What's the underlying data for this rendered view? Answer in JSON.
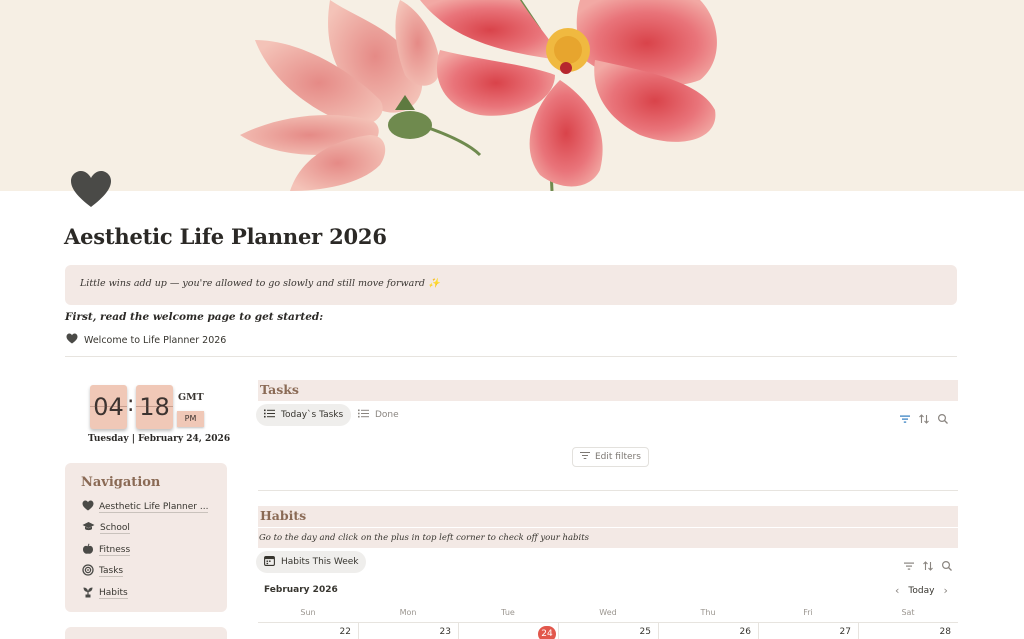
{
  "page": {
    "icon": "heart-icon",
    "title": "Aesthetic Life Planner 2026",
    "callout_text": "Little wins add up — you're allowed to go slowly and still move forward ✨",
    "first_read": "First, read the welcome page to get started:",
    "welcome_link": "Welcome to Life Planner 2026"
  },
  "clock": {
    "hours": "04",
    "separator": ":",
    "minutes": "18",
    "timezone": "GMT",
    "ampm": "PM",
    "date": "Tuesday | February 24, 2026"
  },
  "navigation": {
    "title": "Navigation",
    "items": [
      {
        "label": "Aesthetic Life Planner ...",
        "icon": "heart-icon"
      },
      {
        "label": "School",
        "icon": "graduation-cap-icon"
      },
      {
        "label": "Fitness",
        "icon": "apple-icon"
      },
      {
        "label": "Tasks",
        "icon": "target-icon"
      },
      {
        "label": "Habits",
        "icon": "plant-icon"
      }
    ]
  },
  "tasks": {
    "title": "Tasks",
    "views": [
      {
        "label": "Today`s Tasks",
        "icon": "list-icon",
        "active": true
      },
      {
        "label": "Done",
        "icon": "list-icon",
        "active": false
      }
    ],
    "edit_filters": "Edit filters"
  },
  "habits": {
    "title": "Habits",
    "description": "Go to the day and click on the plus in top left corner to check off your habits",
    "view": {
      "label": "Habits This Week",
      "icon": "calendar-icon"
    },
    "calendar": {
      "month": "February 2026",
      "today_button": "Today",
      "weekdays": [
        "Sun",
        "Mon",
        "Tue",
        "Wed",
        "Thu",
        "Fri",
        "Sat"
      ],
      "days": [
        "22",
        "23",
        "24",
        "25",
        "26",
        "27",
        "28"
      ],
      "today": "24"
    }
  },
  "colors": {
    "accent": "#8a6a55",
    "panel": "#f3e9e5",
    "clock_tile": "#f0c8b7",
    "today": "#e2574c",
    "filter_active": "#2e7bbf"
  }
}
